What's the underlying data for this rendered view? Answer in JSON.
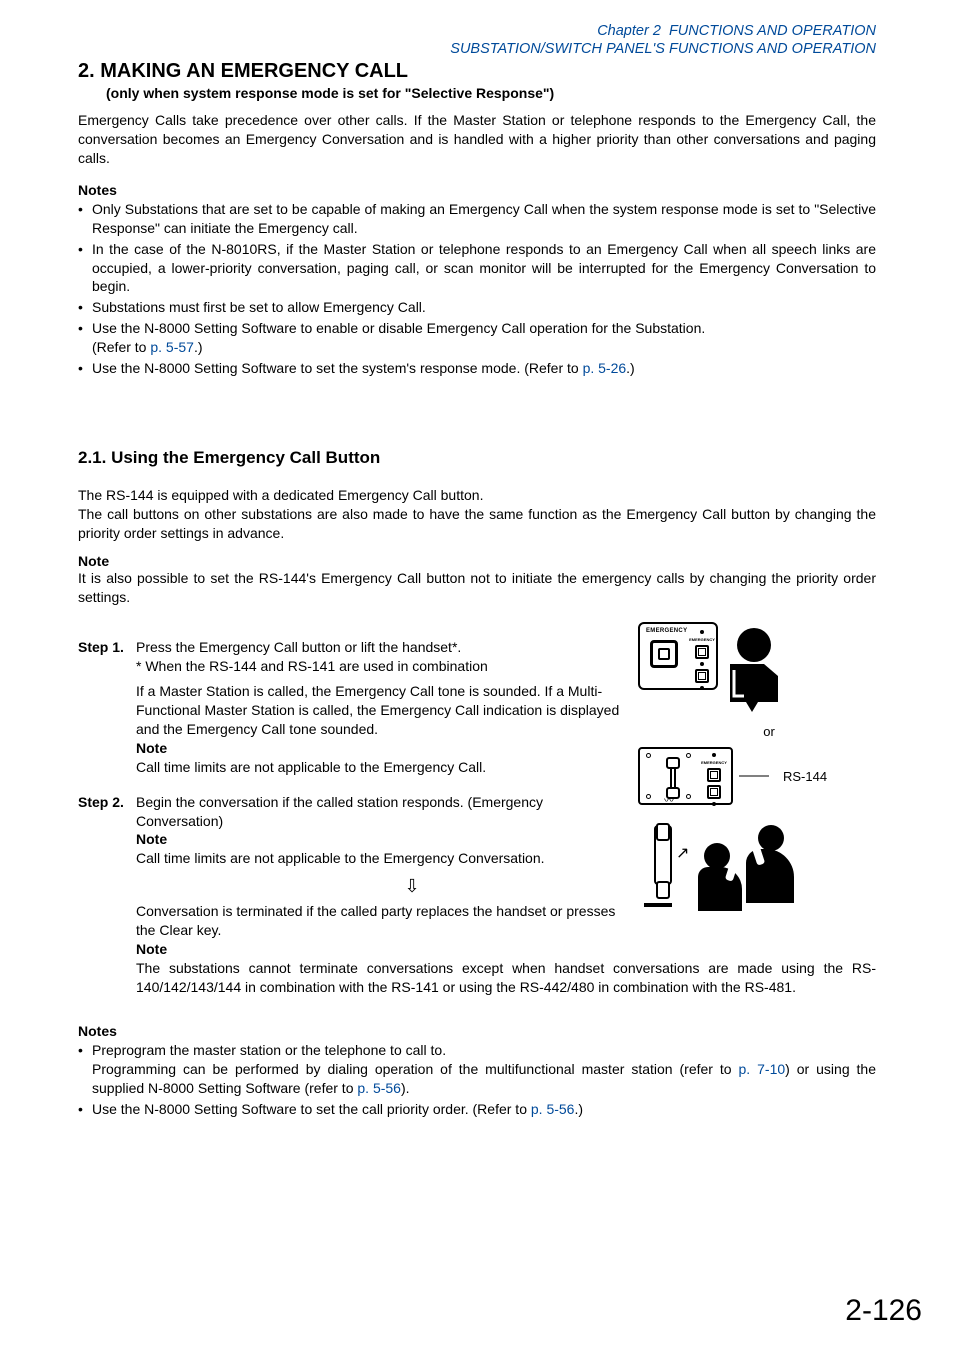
{
  "header": {
    "chapter_italic": "Chapter 2",
    "chapter_title": "FUNCTIONS AND OPERATION",
    "sub_line": "SUBSTATION/SWITCH PANEL'S FUNCTIONS AND OPERATION"
  },
  "section": {
    "number_title": "2. MAKING AN EMERGENCY CALL",
    "subtitle": "(only when system response mode is set for \"Selective Response\")",
    "intro": "Emergency Calls take precedence over other calls. If the Master Station or telephone responds to the Emergency Call, the conversation becomes an Emergency Conversation and is handled with a higher priority than other conversations and paging calls."
  },
  "notes1": {
    "head": "Notes",
    "b1": "Only Substations that are set to be capable of making an Emergency Call when the system response mode is set to \"Selective Response\" can initiate the Emergency call.",
    "b2": "In the case of the N-8010RS, if the Master Station or telephone responds to an Emergency Call when all speech links are occupied, a lower-priority conversation, paging call, or scan monitor will be interrupted for the Emergency Conversation to begin.",
    "b3": "Substations must first be set to allow Emergency Call.",
    "b4_pre": "Use the N-8000 Setting Software to enable or disable Emergency Call operation for the Substation.",
    "b4_refer_open": "(Refer to ",
    "b4_link": "p. 5-57",
    "b4_refer_close": ".)",
    "b5_pre": "Use the N-8000 Setting Software to set the system's response mode. (Refer to ",
    "b5_link": "p. 5-26",
    "b5_post": ".)"
  },
  "sub21": {
    "heading": "2.1. Using the Emergency Call Button",
    "p1": "The RS-144 is equipped with a dedicated Emergency Call button.",
    "p2": "The call buttons on other substations are also made to have the same function as the Emergency Call button by changing the priority order settings in advance.",
    "note_head": "Note",
    "note_body": "It is also possible to set the RS-144's Emergency Call button not to initiate the emergency calls by changing the priority order settings."
  },
  "steps": {
    "s1_label": "Step 1.",
    "s1_l1": "Press the Emergency Call button or lift the handset*.",
    "s1_l2": "* When the RS-144 and RS-141 are used in combination",
    "s1_l3": "If a Master Station is called, the Emergency Call tone is sounded. If a Multi-Functional Master Station is called, the Emergency Call indication is displayed and the Emergency Call tone sounded.",
    "s1_note_h": "Note",
    "s1_note_b": "Call time limits are not applicable to the Emergency Call.",
    "s2_label": "Step 2.",
    "s2_l1": "Begin the conversation if the called station responds. (Emergency Conversation)",
    "s2_note_h": "Note",
    "s2_note_b": "Call time limits are not applicable to the Emergency Conversation.",
    "after_arrow": "Conversation is terminated if the called party replaces the handset or presses the Clear key.",
    "s2_note2_h": "Note",
    "s2_note2_b": "The substations cannot terminate conversations except when handset conversations are made using the RS-140/142/143/144 in combination with the RS-141 or using the RS-442/480 in combination with the RS-481."
  },
  "figure": {
    "emergency_label": "EMERGENCY",
    "emergency_small": "EMERGENCY",
    "or": "or",
    "rs_label": "RS-144"
  },
  "notes2": {
    "head": "Notes",
    "b1_l1": "Preprogram the master station or the telephone to call to.",
    "b1_l2_pre": "Programming can be performed by dialing operation of the multifunctional master station (refer to ",
    "b1_l2_link1": "p. 7-10",
    "b1_l2_mid": ") or using the supplied N-8000 Setting Software (refer to ",
    "b1_l2_link2": "p. 5-56",
    "b1_l2_post": ").",
    "b2_pre": "Use the N-8000 Setting Software to set the call priority order. (Refer to ",
    "b2_link": "p. 5-56",
    "b2_post": ".)"
  },
  "page_number": "2-126"
}
